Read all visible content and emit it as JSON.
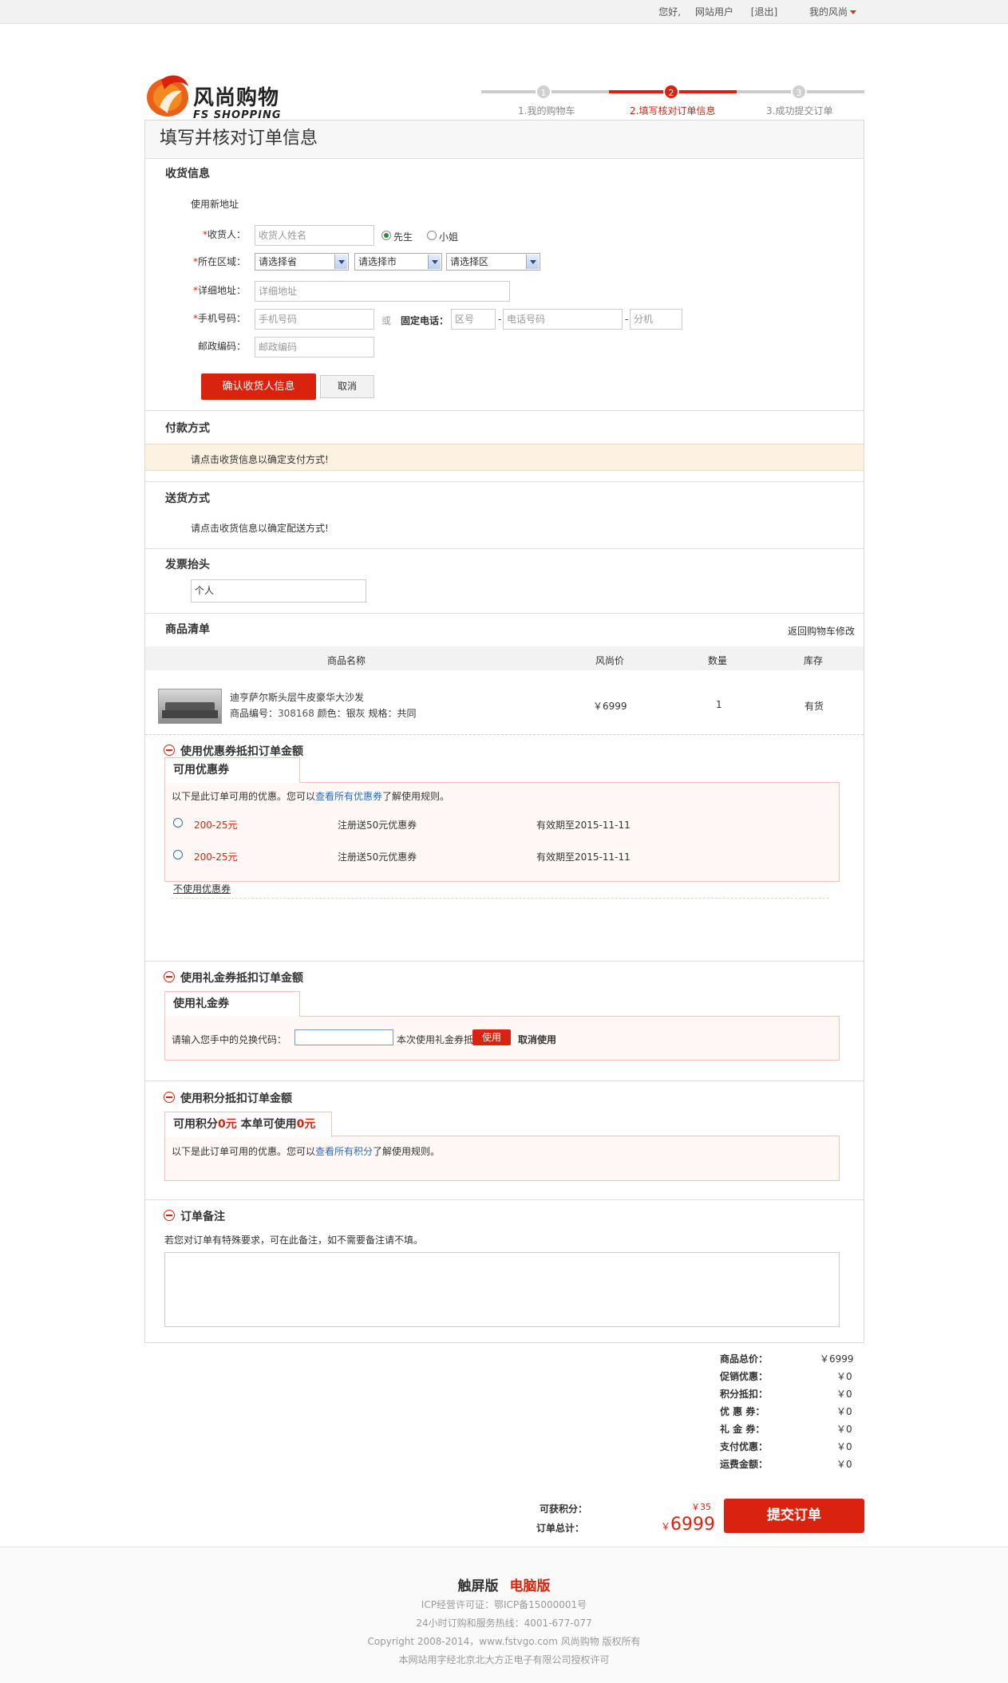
{
  "topbar": {
    "greeting": "您好,",
    "user": "网站用户",
    "logout": "[退出]",
    "my": "我的风尚"
  },
  "logo": {
    "cn": "风尚购物",
    "en": "FS SHOPPING"
  },
  "steps": [
    {
      "num": "1",
      "label": "1.我的购物车"
    },
    {
      "num": "2",
      "label": "2.填写核对订单信息"
    },
    {
      "num": "3",
      "label": "3.成功提交订单"
    }
  ],
  "page_title": "填写并核对订单信息",
  "shipping": {
    "heading": "收货信息",
    "use_new": "使用新地址",
    "name_label": "收货人：",
    "name_placeholder": "收货人姓名",
    "mr": "先生",
    "ms": "小姐",
    "region_label": "所在区域：",
    "province": "请选择省",
    "city": "请选择市",
    "district": "请选择区",
    "addr_label": "详细地址：",
    "addr_placeholder": "详细地址",
    "mobile_label": "手机号码：",
    "mobile_placeholder": "手机号码",
    "or": "或",
    "phone_label": "固定电话：",
    "area_placeholder": "区号",
    "phone_placeholder": "电话号码",
    "ext_placeholder": "分机",
    "zip_label": "邮政编码：",
    "zip_placeholder": "邮政编码",
    "confirm": "确认收货人信息",
    "cancel": "取消"
  },
  "payment": {
    "heading": "付款方式",
    "note": "请点击收货信息以确定支付方式!"
  },
  "delivery": {
    "heading": "送货方式",
    "note": "请点击收货信息以确定配送方式!"
  },
  "invoice": {
    "heading": "发票抬头",
    "value": "个人"
  },
  "goods": {
    "heading": "商品清单",
    "back_link": "返回购物车修改",
    "columns": [
      "商品名称",
      "风尚价",
      "数量",
      "库存"
    ],
    "item": {
      "name": "迪亨萨尔斯头层牛皮豪华大沙发",
      "code_label": "商品编号：",
      "code": "308168",
      "spec": "颜色：银灰 规格：共同",
      "price": "￥6999",
      "qty": "1",
      "stock": "有货"
    }
  },
  "coupon": {
    "heading": "使用优惠券抵扣订单金额",
    "tab": "可用优惠券",
    "intro_a": "以下是此订单可用的优惠。您可以",
    "intro_link": "查看所有优惠券",
    "intro_b": "了解使用规则。",
    "rows": [
      {
        "name": "200-25元",
        "desc": "注册送50元优惠券",
        "expire": "有效期至2015-11-11"
      },
      {
        "name": "200-25元",
        "desc": "注册送50元优惠券",
        "expire": "有效期至2015-11-11"
      }
    ],
    "none": "不使用优惠券"
  },
  "gift": {
    "heading": "使用礼金券抵扣订单金额",
    "tab": "使用礼金券",
    "prompt": "请输入您手中的兑换代码：",
    "deduct": "本次使用礼金券抵扣了元",
    "use": "使用",
    "cancel": "取消使用"
  },
  "points": {
    "heading": "使用积分抵扣订单金额",
    "tab_a": "可用积分",
    "tab_v1": "0元",
    "tab_b": " 本单可使用",
    "tab_v2": "0元",
    "intro_a": "以下是此订单可用的优惠。您可以",
    "intro_link": "查看所有积分",
    "intro_b": "了解使用规则。"
  },
  "remark": {
    "heading": "订单备注",
    "note": "若您对订单有特殊要求，可在此备注，如不需要备注请不填。"
  },
  "summary": [
    {
      "label": "商品总价：",
      "value": "￥6999"
    },
    {
      "label": "促销优惠：",
      "value": "￥0"
    },
    {
      "label": "积分抵扣：",
      "value": "￥0"
    },
    {
      "label": "优 惠 券：",
      "value": "￥0"
    },
    {
      "label": "礼 金 券：",
      "value": "￥0"
    },
    {
      "label": "支付优惠：",
      "value": "￥0"
    },
    {
      "label": "运费金额：",
      "value": "￥0"
    }
  ],
  "total": {
    "points_label": "可获积分：",
    "points": "￥35",
    "total_label": "订单总计：",
    "currency": "￥",
    "amount": "6999",
    "submit": "提交订单"
  },
  "footer": {
    "touch": "触屏版",
    "pc": "电脑版",
    "icp": "ICP经营许可证：鄂ICP备15000001号",
    "hotline": "24小时订购和服务热线：4001-677-077",
    "copyright": "Copyright 2008-2014，www.fstvgo.com 风尚购物 版权所有",
    "license": "本网站用字经北京北大方正电子有限公司授权许可"
  },
  "colors": {
    "accent": "#d9230f",
    "link": "#2a6db5",
    "notice_bg": "#fdf2e1"
  }
}
